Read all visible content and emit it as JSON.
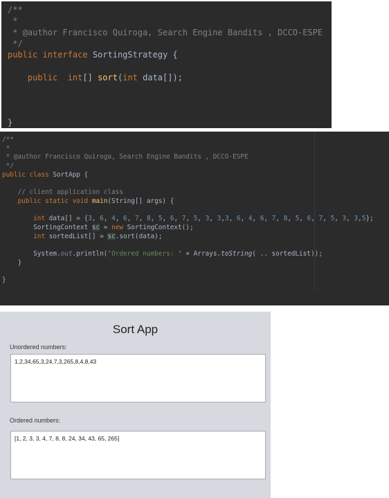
{
  "editor1": {
    "lines": [
      [
        [
          "cm",
          "/**"
        ]
      ],
      [
        [
          "cm",
          " *"
        ]
      ],
      [
        [
          "cm",
          " * @author Francisco Quiroga, Search Engine Bandits , DCCO-ESPE"
        ]
      ],
      [
        [
          "cm",
          " */"
        ]
      ],
      [
        [
          "kw",
          "public interface "
        ],
        [
          "tx",
          "SortingStrategy {"
        ]
      ],
      [],
      [
        [
          "tx",
          "    "
        ],
        [
          "kw",
          "public  int"
        ],
        [
          "tx",
          "[] "
        ],
        [
          "fn",
          "sort"
        ],
        [
          "tx",
          "("
        ],
        [
          "kw",
          "int "
        ],
        [
          "tx",
          "data[]);"
        ]
      ],
      [],
      [],
      [],
      [
        [
          "tx",
          "}"
        ]
      ]
    ]
  },
  "editor2": {
    "lines": [
      [
        [
          "cm",
          "/**"
        ]
      ],
      [
        [
          "cm",
          " *"
        ]
      ],
      [
        [
          "cm",
          " * @author Francisco Quiroga, Search Engine Bandits , DCCO-ESPE"
        ]
      ],
      [
        [
          "cm",
          " */"
        ]
      ],
      [
        [
          "kw",
          "public class "
        ],
        [
          "tx",
          "SortApp {"
        ]
      ],
      [],
      [
        [
          "cm",
          "    // client application class"
        ]
      ],
      [
        [
          "kw",
          "    public static void "
        ],
        [
          "fn",
          "main"
        ],
        [
          "tx",
          "(String[] args) {"
        ]
      ],
      [],
      [
        [
          "kw",
          "        int "
        ],
        [
          "tx",
          "data[] = {"
        ],
        [
          "num",
          "3"
        ],
        [
          "tx",
          ", "
        ],
        [
          "num",
          "6"
        ],
        [
          "tx",
          ", "
        ],
        [
          "num",
          "4"
        ],
        [
          "tx",
          ", "
        ],
        [
          "num",
          "6"
        ],
        [
          "tx",
          ", "
        ],
        [
          "num",
          "7"
        ],
        [
          "tx",
          ", "
        ],
        [
          "num",
          "8"
        ],
        [
          "tx",
          ", "
        ],
        [
          "num",
          "5"
        ],
        [
          "tx",
          ", "
        ],
        [
          "num",
          "6"
        ],
        [
          "tx",
          ", "
        ],
        [
          "num",
          "7"
        ],
        [
          "tx",
          ", "
        ],
        [
          "num",
          "5"
        ],
        [
          "tx",
          ", "
        ],
        [
          "num",
          "3"
        ],
        [
          "tx",
          ", "
        ],
        [
          "num",
          "3"
        ],
        [
          "tx",
          ","
        ],
        [
          "num",
          "3"
        ],
        [
          "tx",
          ", "
        ],
        [
          "num",
          "6"
        ],
        [
          "tx",
          ", "
        ],
        [
          "num",
          "4"
        ],
        [
          "tx",
          ", "
        ],
        [
          "num",
          "6"
        ],
        [
          "tx",
          ", "
        ],
        [
          "num",
          "7"
        ],
        [
          "tx",
          ", "
        ],
        [
          "num",
          "8"
        ],
        [
          "tx",
          ", "
        ],
        [
          "num",
          "5"
        ],
        [
          "tx",
          ", "
        ],
        [
          "num",
          "6"
        ],
        [
          "tx",
          ", "
        ],
        [
          "num",
          "7"
        ],
        [
          "tx",
          ", "
        ],
        [
          "num",
          "5"
        ],
        [
          "tx",
          ", "
        ],
        [
          "num",
          "3"
        ],
        [
          "tx",
          ", "
        ],
        [
          "num",
          "3"
        ],
        [
          "tx",
          ","
        ],
        [
          "num",
          "5"
        ],
        [
          "tx",
          "};"
        ]
      ],
      [
        [
          "tx",
          "        SortingContext "
        ],
        [
          "hl",
          "sc"
        ],
        [
          "tx",
          " = "
        ],
        [
          "kw",
          "new "
        ],
        [
          "tx",
          "SortingContext();"
        ]
      ],
      [
        [
          "kw",
          "        int "
        ],
        [
          "tx",
          "sortedList[] = "
        ],
        [
          "hl",
          "sc"
        ],
        [
          "tx",
          ".sort(data);"
        ]
      ],
      [],
      [
        [
          "tx",
          "        System."
        ],
        [
          "st",
          "out"
        ],
        [
          "tx",
          ".println("
        ],
        [
          "str",
          "\"Ordered numbers: \""
        ],
        [
          "tx",
          " + Arrays."
        ],
        [
          "it",
          "toString"
        ],
        [
          "tx",
          "( .. sortedList));"
        ]
      ],
      [
        [
          "tx",
          "    }"
        ]
      ],
      [],
      [
        [
          "tx",
          "}"
        ]
      ]
    ]
  },
  "app": {
    "title": "Sort App",
    "unordered_label": "Unordered numbers:",
    "unordered_value": "1,2,34,65,3,24,7,3,265,8,4,8,43",
    "ordered_label": "Ordered numbers:",
    "ordered_value": "[1, 2, 3, 3, 4, 7, 8, 8, 24, 34, 43, 65, 265]"
  }
}
